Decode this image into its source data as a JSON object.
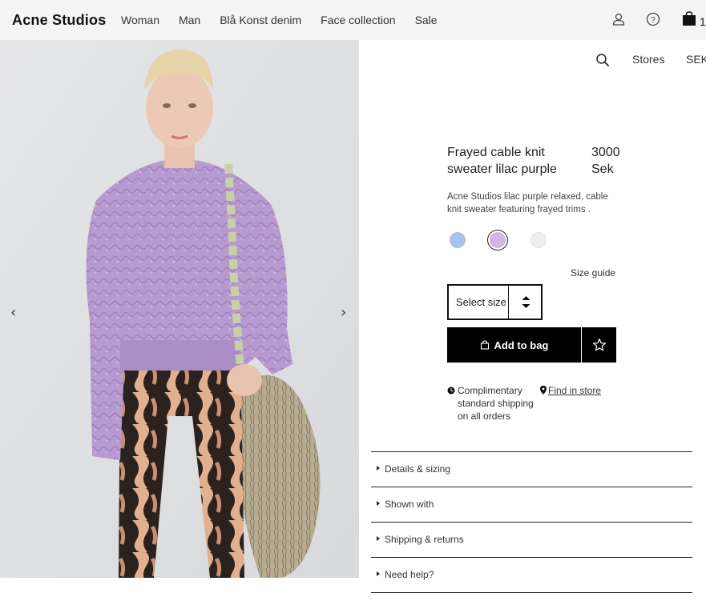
{
  "header": {
    "logo": "Acne Studios",
    "nav": [
      "Woman",
      "Man",
      "Blå Konst denim",
      "Face collection",
      "Sale"
    ],
    "bag_count": "1",
    "icons": [
      "account-icon",
      "help-icon",
      "bag-icon"
    ]
  },
  "utility": {
    "stores_label": "Stores",
    "currency_label": "SEK"
  },
  "product": {
    "name": "Frayed cable knit sweater lilac purple",
    "price": "3000 Sek",
    "description": "Acne Studios lilac purple relaxed, cable knit sweater featuring frayed trims .",
    "swatches": [
      {
        "color": "#a9c3ee",
        "selected": false
      },
      {
        "color": "#d4b5e8",
        "selected": true
      },
      {
        "color": "#eeeeee",
        "selected": false
      }
    ],
    "size_guide": "Size guide",
    "size_select": "Select size",
    "add_to_bag": "Add to bag",
    "shipping_info": "Complimentary standard shipping on all orders",
    "find_in_store": "Find in store"
  },
  "accordion": [
    "Details & sizing",
    "Shown with",
    "Shipping & returns",
    "Need help?"
  ],
  "gallery": {
    "prev_arrow": "‹",
    "next_arrow": "›"
  }
}
